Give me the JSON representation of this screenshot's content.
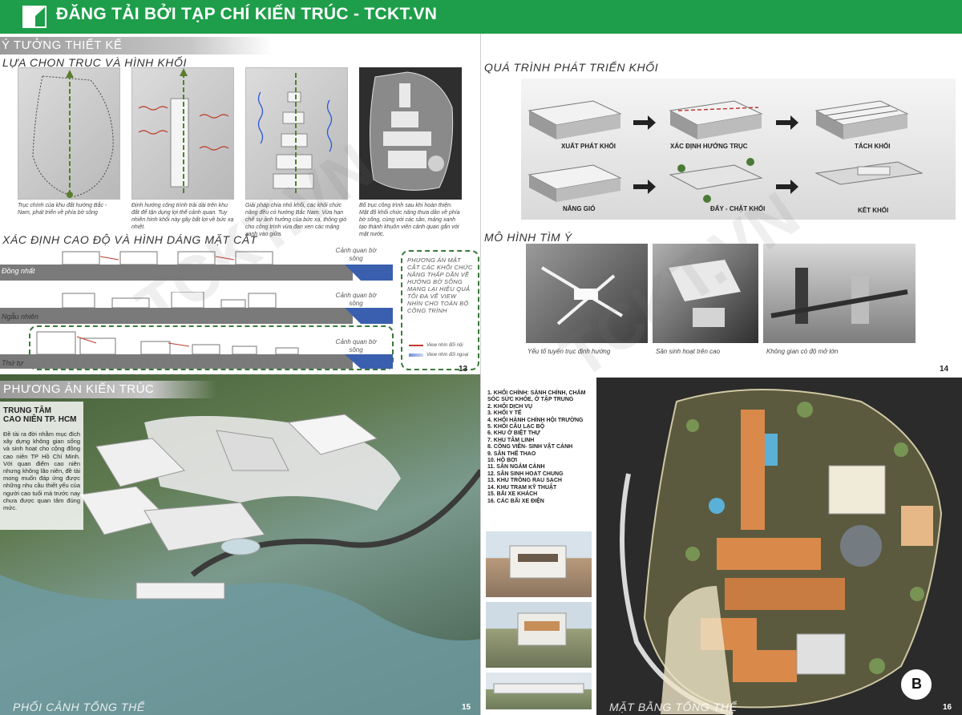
{
  "header": {
    "title": "ĐĂNG TẢI BỞI TẠP CHÍ KIẾN TRÚC - TCKT.VN"
  },
  "p13": {
    "section_title": "Ý TƯỞNG THIẾT KẾ",
    "sub1": "LỰA CHỌN TRỤC VÀ HÌNH KHỐI",
    "captions": [
      "Trục chính của khu đất hướng Bắc - Nam, phát triển về phía bờ sông",
      "Định hướng công trình trải dài trên khu đất để tận dụng lợi thế cảnh quan. Tuy nhiên hình khối này gây bất lợi về bức xạ nhiệt.",
      "Giải pháp chia nhỏ khối, các khối chức năng đều có hướng Bắc Nam. Vừa hạn chế sự ảnh hưởng của bức xạ, thông gió cho công trình vừa đan xen các mảng xanh vào giữa.",
      "Bố trục công trình sau khi hoàn thiện. Mật độ khối chức năng thưa dần về phía bờ sông, cùng với các sân, mảng xanh tạo thành khuôn viên cảnh quan gắn với mặt nước."
    ],
    "sub2": "XÁC ĐỊNH CAO ĐỘ VÀ HÌNH DÁNG MẶT CẮT",
    "rows": [
      "Đồng nhất",
      "Ngẫu nhiên",
      "Thứ tự"
    ],
    "river_label": "Cảnh quan bờ sông",
    "note": "PHƯƠNG ÁN MẶT CẮT CÁC KHỐI CHỨC NĂNG THẤP DẦN VỀ HƯỚNG BỜ SÔNG MANG LẠI HIỆU QUẢ TỐI ĐA VỀ VIEW NHÌN CHO TOÀN BỘ CÔNG TRÌNH",
    "legend_inner": "View nhìn đối nội",
    "legend_outer": "View nhìn đối ngoại",
    "page": "13"
  },
  "p14": {
    "title": "QUÁ TRÌNH PHÁT TRIỂN KHỐI",
    "steps": [
      "XUẤT PHÁT KHỐI",
      "XÁC ĐỊNH HƯỚNG TRỤC",
      "TÁCH KHỐI",
      "NẮNG GIÓ",
      "ĐẨY - CHẶT KHỐI",
      "KẾT KHỐI"
    ],
    "title2": "MÔ HÌNH TÌM Ý",
    "models": [
      "Yếu tố tuyến trục định hướng",
      "Sân sinh hoạt trên cao",
      "Không gian có độ mở lớn"
    ],
    "page": "14"
  },
  "p15": {
    "section_title": "PHƯƠNG ÁN KIẾN TRÚC",
    "project_title_1": "TRUNG TÂM",
    "project_title_2": "CAO NIÊN TP. HCM",
    "description": "Đề tài ra đời nhằm mục đích xây dựng không gian sống và sinh hoạt cho cộng đồng cao niên TP Hồ Chí Minh. Với quan điểm cao niên nhưng không lão niên, đề tài mong muốn đáp ứng được những nhu cầu thiết yếu của người cao tuổi mà trước nay chưa được quan tâm đúng mức.",
    "caption": "PHỐI CẢNH TỔNG THỂ",
    "page": "15"
  },
  "p16": {
    "legend": [
      "1. KHỐI CHÍNH: SẢNH CHÍNH, CHĂM SÓC SỨC KHỎE, Ở TẬP TRUNG",
      "2. KHỐI DỊCH VỤ",
      "3. KHỐI Y TẾ",
      "4. KHỐI HÀNH CHÍNH HỘI TRƯỜNG",
      "5. KHỐI CÂU LẠC BỘ",
      "6. KHU Ở BIỆT THỰ",
      "7. KHU TÂM LINH",
      "8. CÔNG VIÊN- SINH VẬT CẢNH",
      "9. SÂN THỂ THAO",
      "10. HỒ BƠI",
      "11. SÂN NGẮM CẢNH",
      "12. SÂN SINH HOẠT CHUNG",
      "13. KHU TRỒNG RAU SẠCH",
      "14. KHU TRẠM KỸ THUẬT",
      "15. BÃI XE KHÁCH",
      "16. CÁC BÃI XE ĐIỆN"
    ],
    "caption": "MẶT BẰNG TỔNG THỂ",
    "north": "B",
    "page": "16"
  },
  "watermark": "TCKT.VN",
  "colors": {
    "header_green": "#1e9e4a",
    "river": "#3a5fae",
    "roof_orange": "#d9894a",
    "note_border": "#3a7a3a"
  }
}
